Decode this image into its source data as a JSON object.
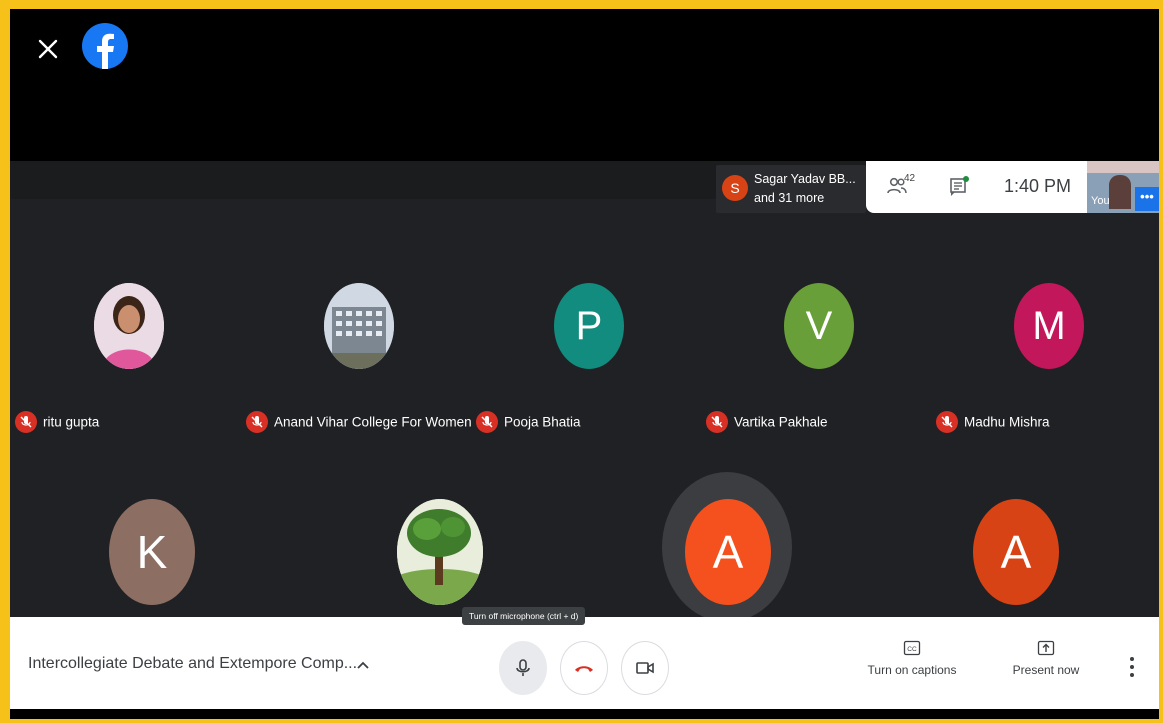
{
  "presenter": {
    "initial": "S",
    "name": "Sagar Yadav BB...",
    "more": "and 31 more",
    "color": "#d84315"
  },
  "infobar": {
    "participant_count": "42",
    "time": "1:40 PM"
  },
  "self_view": {
    "label": "You",
    "menu_glyph": "•••"
  },
  "participants_row1": [
    {
      "name": "ritu gupta",
      "avatar_type": "photo"
    },
    {
      "name": "Anand Vihar College For Women",
      "avatar_type": "photo"
    },
    {
      "name": "Pooja Bhatia",
      "initial": "P",
      "color": "#128c7e"
    },
    {
      "name": "Vartika Pakhale",
      "initial": "V",
      "color": "#689f38"
    },
    {
      "name": "Madhu Mishra",
      "initial": "M",
      "color": "#c2185b"
    }
  ],
  "participants_row2": [
    {
      "initial": "K",
      "color": "#8d6e63"
    },
    {
      "avatar_type": "photo"
    },
    {
      "initial": "A",
      "color": "#f4511e",
      "speaking": true
    },
    {
      "initial": "A",
      "color": "#d84315"
    }
  ],
  "controls": {
    "meeting_title": "Intercollegiate Debate and Extempore Comp...",
    "mic_tooltip": "Turn off microphone (ctrl + d)",
    "captions_label": "Turn on captions",
    "captions_icon_text": "CC",
    "present_label": "Present now"
  },
  "colors": {
    "frame_border": "#f6c21a",
    "mic_off": "#d93025",
    "hangup": "#d93025",
    "facebook": "#1877f2"
  }
}
